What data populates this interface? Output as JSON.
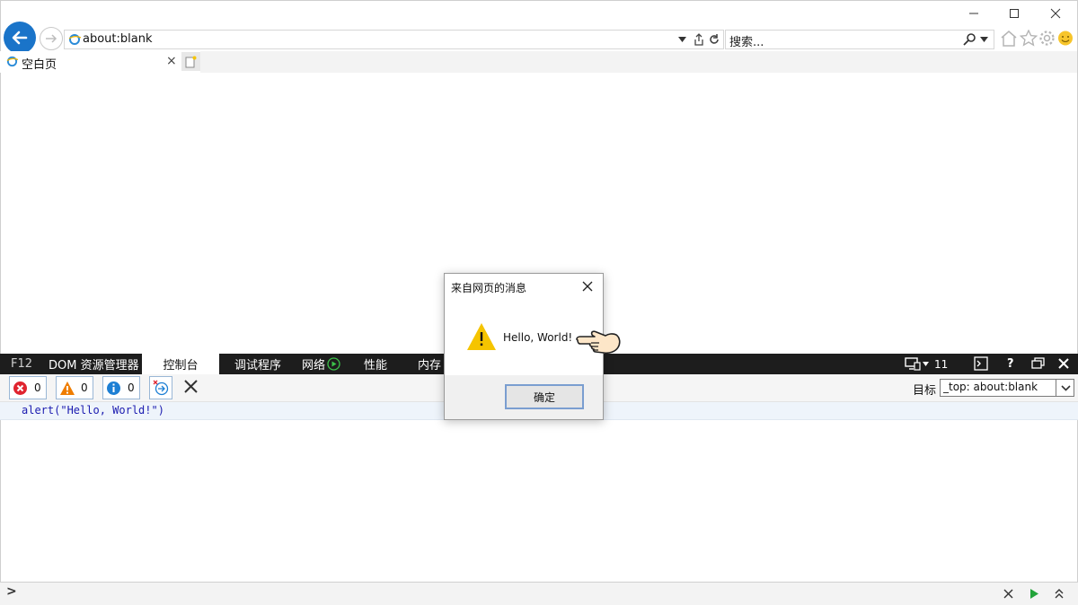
{
  "window": {
    "minimize_glyph": "—",
    "maximize_glyph": "☐",
    "close_glyph": "✕"
  },
  "navbar": {
    "address": "about:blank",
    "search_placeholder": "搜索..."
  },
  "tabs": [
    {
      "label": "空白页",
      "close_glyph": "×"
    }
  ],
  "devtools": {
    "f12_label": "F12",
    "tabs": [
      "DOM 资源管理器",
      "控制台",
      "调试程序",
      "网络",
      "性能",
      "内存"
    ],
    "active_tab": "控制台",
    "emulation_count": "11",
    "help_glyph": "?",
    "close_glyph": "✕",
    "console": {
      "error_count": "0",
      "warning_count": "0",
      "info_count": "0",
      "target_label": "目标",
      "target_value": "_top: about:blank",
      "entry": "alert(\"Hello, World!\")",
      "prompt_glyph": ">"
    }
  },
  "dialog": {
    "title": "来自网页的消息",
    "message": "Hello, World!",
    "ok_label": "确定"
  },
  "colors": {
    "accent": "#1a74c9",
    "devbar": "#1d1d1d",
    "warning": "#f5c400"
  }
}
